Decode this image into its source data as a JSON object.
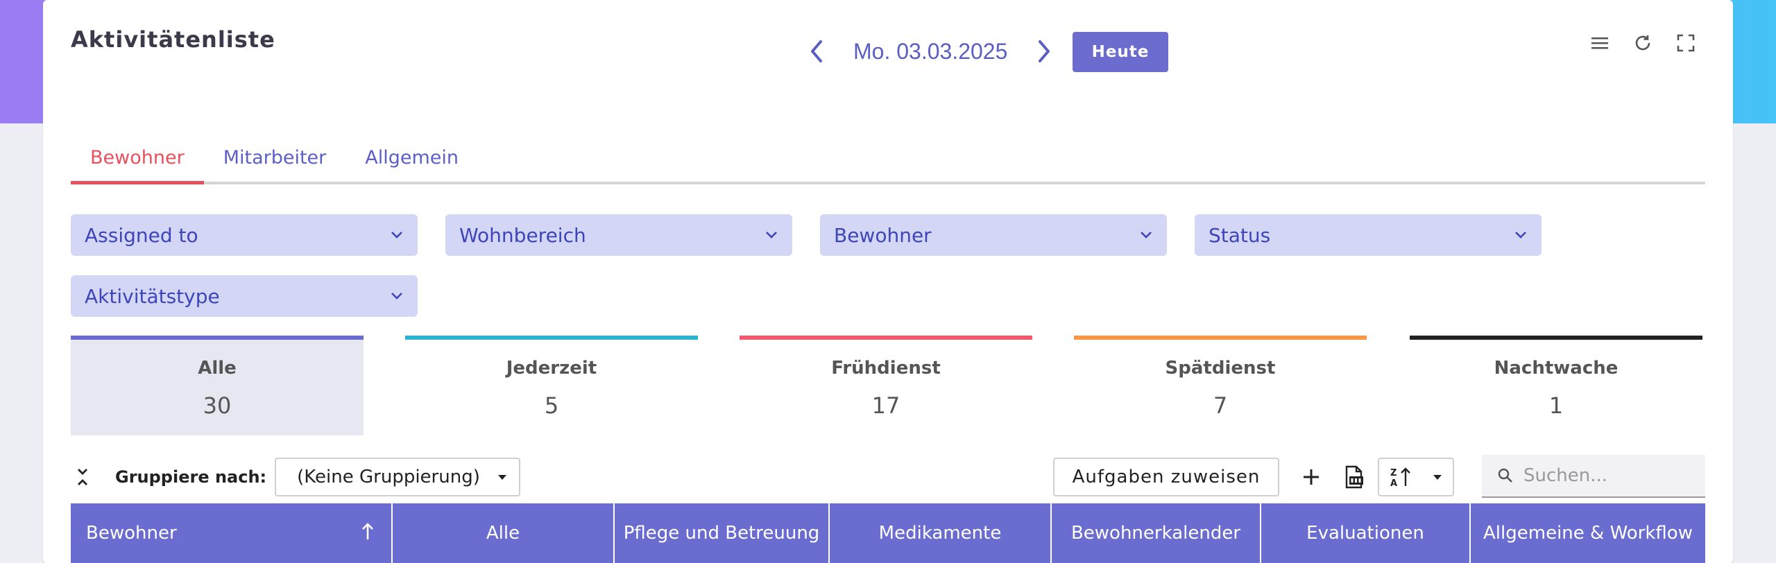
{
  "header": {
    "title": "Aktivitätenliste",
    "date": "Mo. 03.03.2025",
    "today_label": "Heute"
  },
  "tabs": [
    {
      "label": "Bewohner",
      "active": true
    },
    {
      "label": "Mitarbeiter",
      "active": false
    },
    {
      "label": "Allgemein",
      "active": false
    }
  ],
  "filters": [
    {
      "label": "Assigned to"
    },
    {
      "label": "Wohnbereich"
    },
    {
      "label": "Bewohner"
    },
    {
      "label": "Status"
    },
    {
      "label": "Aktivitätstype"
    }
  ],
  "shift_stats": [
    {
      "name": "Alle",
      "value": "30",
      "color": "#6b6ccf",
      "selected": true
    },
    {
      "name": "Jederzeit",
      "value": "5",
      "color": "#2bb3cf",
      "selected": false
    },
    {
      "name": "Frühdienst",
      "value": "17",
      "color": "#ef5a6e",
      "selected": false
    },
    {
      "name": "Spätdienst",
      "value": "7",
      "color": "#f79548",
      "selected": false
    },
    {
      "name": "Nachtwache",
      "value": "1",
      "color": "#222222",
      "selected": false
    }
  ],
  "toolbar": {
    "group_label": "Gruppiere nach:",
    "group_value": "(Keine Gruppierung)",
    "assign_label": "Aufgaben zuweisen",
    "search_placeholder": "Suchen..."
  },
  "table": {
    "columns": [
      "Bewohner",
      "Alle",
      "Pflege und Betreuung",
      "Medikamente",
      "Bewohnerkalender",
      "Evaluationen",
      "Allgemeine & Workflow"
    ],
    "sorted_column": "Bewohner",
    "sort_direction": "ascending"
  },
  "colors": {
    "accent": "#6b6ccf",
    "active_tab": "#e9505d",
    "filter_bg": "#d3d6f5"
  }
}
